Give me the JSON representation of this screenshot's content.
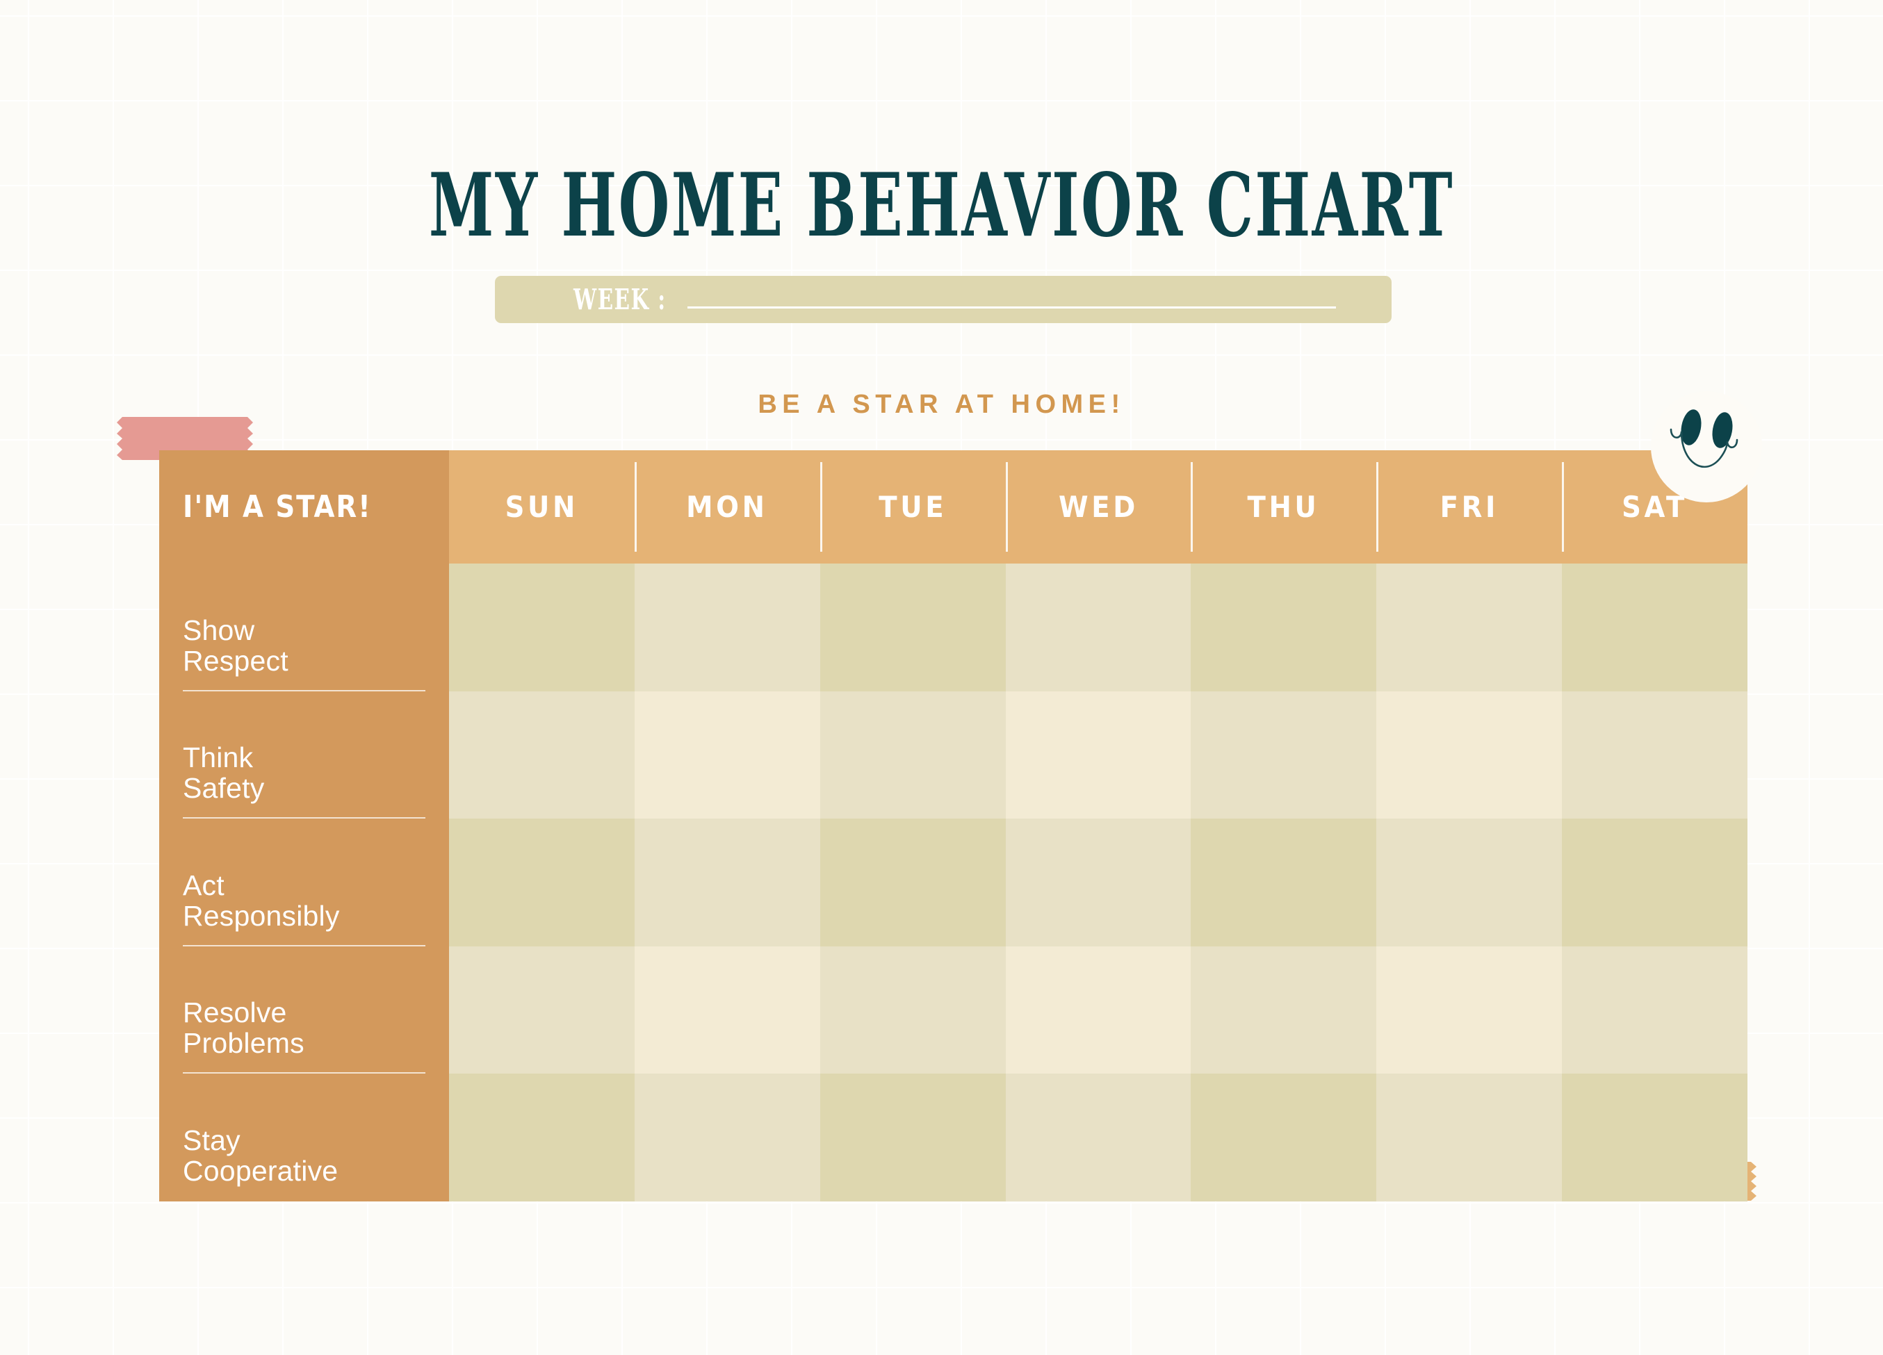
{
  "page": {
    "title": "MY HOME BEHAVIOR CHART",
    "subtitle": "BE A STAR AT HOME!",
    "background_color": "#FCFBF7",
    "title_color": "#0C4249",
    "subtitle_color": "#D2974F"
  },
  "week_field": {
    "label": "WEEK :",
    "value": "",
    "placeholder": "",
    "bar_color": "#DED7AF",
    "text_color": "#FFFFFF"
  },
  "table": {
    "row_header_label": "I'M A STAR!",
    "row_header_bg": "#D3995C",
    "day_header_bg": "#E5B375",
    "columns": [
      "SUN",
      "MON",
      "TUE",
      "WED",
      "THU",
      "FRI",
      "SAT"
    ],
    "rows": [
      {
        "line1": "Show",
        "line2": "Respect"
      },
      {
        "line1": "Think",
        "line2": "Safety"
      },
      {
        "line1": "Act",
        "line2": "Responsibly"
      },
      {
        "line1": "Resolve",
        "line2": "Problems"
      },
      {
        "line1": "Stay",
        "line2": "Cooperative"
      }
    ],
    "cell_colors": {
      "dark": "#DED7AF",
      "medium": "#E8E1C6",
      "light": "#F3EBD4"
    },
    "cell_values": [
      [
        "",
        "",
        "",
        "",
        "",
        "",
        ""
      ],
      [
        "",
        "",
        "",
        "",
        "",
        "",
        ""
      ],
      [
        "",
        "",
        "",
        "",
        "",
        "",
        ""
      ],
      [
        "",
        "",
        "",
        "",
        "",
        "",
        ""
      ],
      [
        "",
        "",
        "",
        "",
        "",
        "",
        ""
      ]
    ]
  },
  "decorations": {
    "tape_pink_color": "#E59A93",
    "tape_orange_color": "#E5B375",
    "smiley_color": "#0C4249",
    "smiley_face_color": "#FDFBF6"
  }
}
